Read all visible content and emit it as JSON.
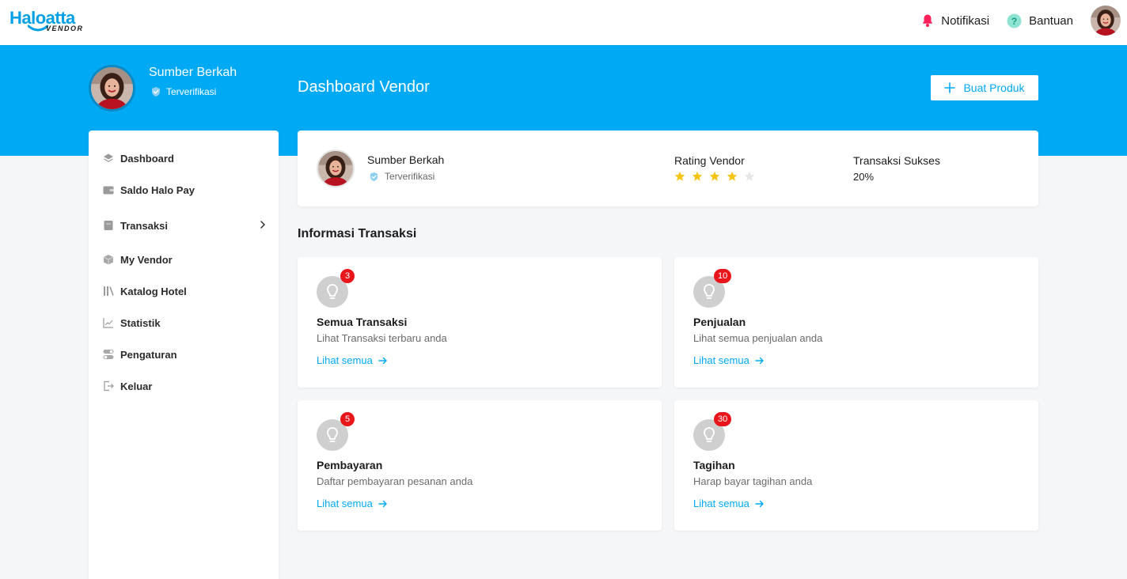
{
  "app": {
    "logo_text": "Haloatta",
    "logo_sub": "VENDOR",
    "brand_color": "#00a9f4"
  },
  "nav": {
    "notifications_label": "Notifikasi",
    "help_label": "Bantuan",
    "notification_icon": "bell-icon",
    "help_icon": "help-circle-icon"
  },
  "profile": {
    "name": "Sumber Berkah",
    "verified_label": "Terverifikasi"
  },
  "page": {
    "title": "Dashboard Vendor",
    "create_button": "Buat Produk"
  },
  "sidebar": {
    "items": [
      {
        "label": "Dashboard",
        "icon": "layers-icon"
      },
      {
        "label": "Saldo Halo Pay",
        "icon": "wallet-icon"
      },
      {
        "label": "Transaksi",
        "icon": "receipt-icon"
      },
      {
        "label": "My Vendor",
        "icon": "box-icon"
      },
      {
        "label": "Katalog Hotel",
        "icon": "books-icon"
      },
      {
        "label": "Statistik",
        "icon": "line-chart-icon"
      },
      {
        "label": "Pengaturan",
        "icon": "toggle-icon"
      },
      {
        "label": "Keluar",
        "icon": "logout-icon"
      }
    ]
  },
  "vendor_card": {
    "name": "Sumber Berkah",
    "verified_label": "Terverifikasi",
    "rating_label": "Rating Vendor",
    "rating": 4,
    "rating_max": 5,
    "success_label": "Transaksi Sukses",
    "success_value": "20%",
    "star_color": "#f5c518"
  },
  "info_section": {
    "title": "Informasi Transaksi",
    "cards": [
      {
        "badge": "3",
        "title": "Semua Transaksi",
        "desc": "Lihat Transaksi terbaru anda",
        "link": "Lihat semua"
      },
      {
        "badge": "10",
        "title": "Penjualan",
        "desc": "Lihat semua penjualan anda",
        "link": "Lihat semua"
      },
      {
        "badge": "5",
        "title": "Pembayaran",
        "desc": "Daftar pembayaran pesanan anda",
        "link": "Lihat semua"
      },
      {
        "badge": "30",
        "title": "Tagihan",
        "desc": "Harap bayar tagihan anda",
        "link": "Lihat semua"
      }
    ]
  }
}
